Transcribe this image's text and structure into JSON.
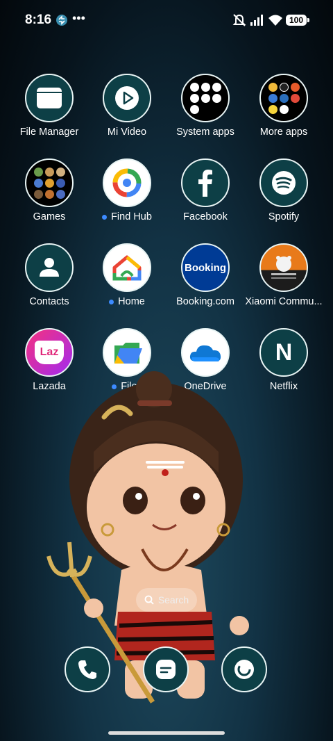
{
  "status_bar": {
    "time": "8:16",
    "battery": "100"
  },
  "apps": [
    {
      "label": "File Manager"
    },
    {
      "label": "Mi Video"
    },
    {
      "label": "System apps"
    },
    {
      "label": "More apps"
    },
    {
      "label": "Games"
    },
    {
      "label": "Find Hub"
    },
    {
      "label": "Facebook"
    },
    {
      "label": "Spotify"
    },
    {
      "label": "Contacts"
    },
    {
      "label": "Home"
    },
    {
      "label": "Booking.com",
      "icon_text": "Booking"
    },
    {
      "label": "Xiaomi Commu..."
    },
    {
      "label": "Lazada",
      "icon_text": "Laz"
    },
    {
      "label": "Files"
    },
    {
      "label": "OneDrive"
    },
    {
      "label": "Netflix",
      "icon_text": "N"
    }
  ],
  "search": {
    "label": "Search"
  },
  "dock": [
    "phone-icon",
    "messages-icon",
    "browser-icon"
  ],
  "colors": {
    "icon_ring": "#e8f4f4",
    "icon_fill": "#0d3f46",
    "notification_dot": "#3d8bff"
  }
}
